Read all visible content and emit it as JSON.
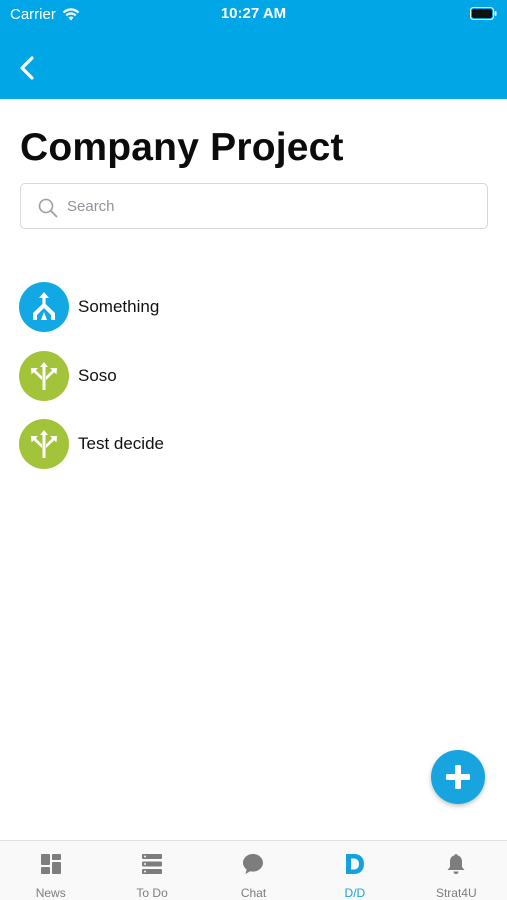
{
  "status_bar": {
    "carrier": "Carrier",
    "time": "10:27 AM",
    "icons": [
      "wifi-icon",
      "battery-icon"
    ]
  },
  "nav": {
    "back_icon": "chevron-left-icon"
  },
  "page": {
    "title": "Company Project"
  },
  "search": {
    "placeholder": "Search",
    "value": "",
    "icon": "search-icon"
  },
  "items": [
    {
      "label": "Something",
      "icon": "merge-arrows-icon",
      "color": "#12a8e4"
    },
    {
      "label": "Soso",
      "icon": "split-arrows-icon",
      "color": "#a3c33b"
    },
    {
      "label": "Test decide",
      "icon": "split-arrows-icon",
      "color": "#a3c33b"
    }
  ],
  "fab": {
    "icon": "plus-icon",
    "color": "#18a4df"
  },
  "tabs": [
    {
      "label": "News",
      "icon": "grid-icon",
      "active": false
    },
    {
      "label": "To Do",
      "icon": "list-icon",
      "active": false
    },
    {
      "label": "Chat",
      "icon": "chat-bubble-icon",
      "active": false
    },
    {
      "label": "D/D",
      "icon": "d-letter-icon",
      "active": true
    },
    {
      "label": "Strat4U",
      "icon": "bell-icon",
      "active": false
    }
  ],
  "colors": {
    "header": "#00a6e6",
    "accent": "#14a2de",
    "inactive_tab": "#7d7d7d"
  }
}
